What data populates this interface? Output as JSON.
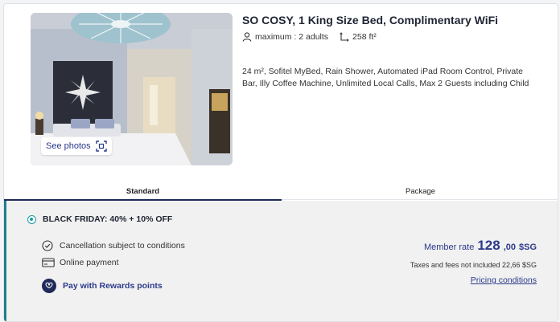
{
  "room": {
    "title": "SO COSY, 1 King Size Bed, Complimentary WiFi",
    "occupancy": "maximum : 2 adults",
    "size": "258 ft²",
    "description": "24 m², Sofitel MyBed, Rain Shower, Automated iPad Room Control, Private Bar, Illy Coffee Machine, Unlimited Local Calls, Max 2 Guests including Child",
    "see_photos_label": "See photos"
  },
  "tabs": [
    {
      "label": "Standard",
      "active": true
    },
    {
      "label": "Package",
      "active": false
    }
  ],
  "offer": {
    "title": "BLACK FRIDAY: 40% + 10% OFF",
    "selected": true,
    "cancellation": "Cancellation subject to conditions",
    "payment": "Online payment",
    "rewards_label": "Pay with Rewards points",
    "member_rate_label": "Member rate",
    "price_integer": "128",
    "price_decimals": ",00",
    "currency": "$SG",
    "taxes_note": "Taxes and fees not included 22,66 $SG",
    "pricing_conditions_label": "Pricing conditions"
  },
  "colors": {
    "accent_teal": "#1f9aa5",
    "brand_navy": "#1f2a5a",
    "link_blue": "#2b3a8a"
  },
  "icons": [
    "person-icon",
    "room-size-icon",
    "gallery-icon",
    "clock-check-icon",
    "credit-card-icon",
    "rewards-icon"
  ]
}
